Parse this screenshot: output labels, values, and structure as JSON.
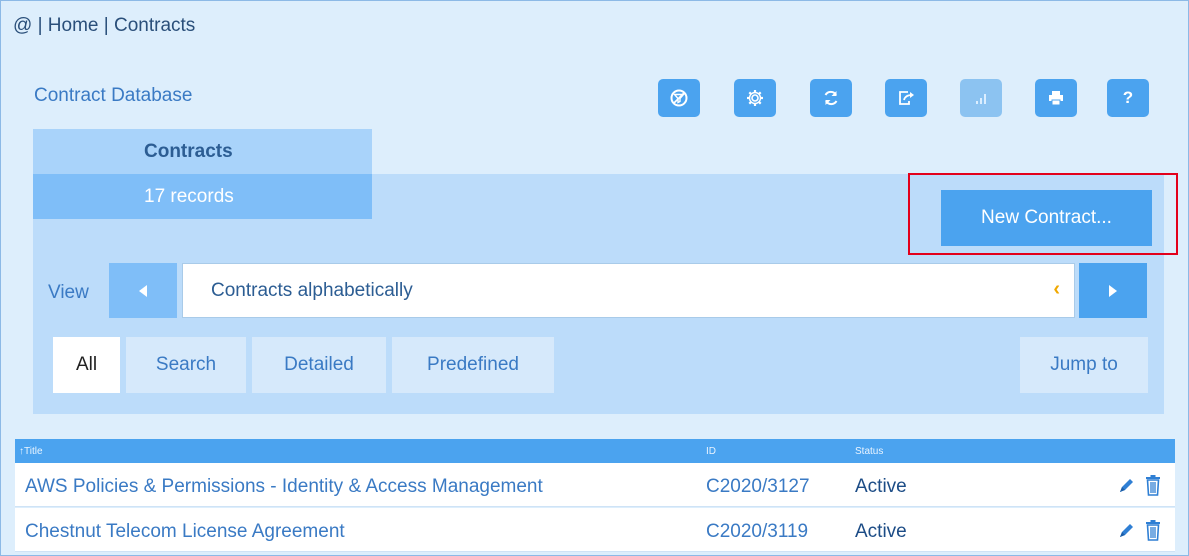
{
  "breadcrumb": {
    "root": "@",
    "sep1": " | ",
    "home": "Home",
    "sep2": " | ",
    "current": "Contracts"
  },
  "header": {
    "title": "Contract Database"
  },
  "toolbar": [
    {
      "name": "filter-off-icon"
    },
    {
      "name": "settings-icon"
    },
    {
      "name": "refresh-icon"
    },
    {
      "name": "export-icon"
    },
    {
      "name": "chart-icon",
      "disabled": true
    },
    {
      "name": "print-icon"
    },
    {
      "name": "help-icon",
      "label": "?"
    }
  ],
  "panel": {
    "title": "Contracts",
    "records": "17 records",
    "new_button": "New Contract..."
  },
  "view": {
    "label": "View",
    "selected": "Contracts alphabetically"
  },
  "tabs": {
    "all": "All",
    "search": "Search",
    "detailed": "Detailed",
    "predefined": "Predefined",
    "jump": "Jump to"
  },
  "table": {
    "columns": {
      "title": "↑Title",
      "id": "ID",
      "status": "Status"
    },
    "rows": [
      {
        "title": "AWS Policies & Permissions - Identity & Access Management",
        "id": "C2020/3127",
        "status": "Active"
      },
      {
        "title": "Chestnut Telecom License Agreement",
        "id": "C2020/3119",
        "status": "Active"
      }
    ]
  },
  "colors": {
    "accent": "#4ba3ef",
    "panel": "#bcdcfa",
    "background": "#ddeefc",
    "highlight": "#e3001b"
  }
}
